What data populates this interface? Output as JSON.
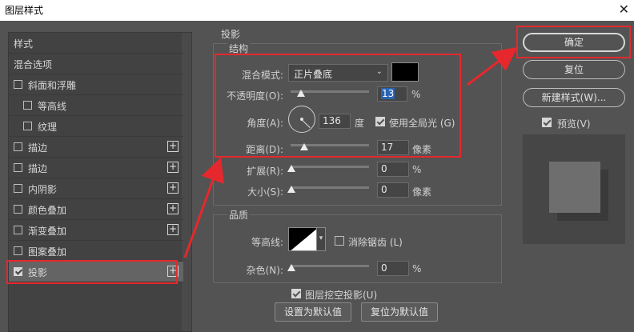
{
  "window": {
    "title": "图层样式",
    "close_glyph": "✕"
  },
  "sidebar": {
    "items": [
      {
        "label": "样式",
        "checkbox": false,
        "checked": false,
        "plus": false,
        "indent": 0
      },
      {
        "label": "混合选项",
        "checkbox": false,
        "checked": false,
        "plus": false,
        "indent": 0
      },
      {
        "label": "斜面和浮雕",
        "checkbox": true,
        "checked": false,
        "plus": false,
        "indent": 0
      },
      {
        "label": "等高线",
        "checkbox": true,
        "checked": false,
        "plus": false,
        "indent": 1
      },
      {
        "label": "纹理",
        "checkbox": true,
        "checked": false,
        "plus": false,
        "indent": 1
      },
      {
        "label": "描边",
        "checkbox": true,
        "checked": false,
        "plus": true,
        "indent": 0
      },
      {
        "label": "描边",
        "checkbox": true,
        "checked": false,
        "plus": true,
        "indent": 0
      },
      {
        "label": "内阴影",
        "checkbox": true,
        "checked": false,
        "plus": true,
        "indent": 0
      },
      {
        "label": "颜色叠加",
        "checkbox": true,
        "checked": false,
        "plus": true,
        "indent": 0
      },
      {
        "label": "渐变叠加",
        "checkbox": true,
        "checked": false,
        "plus": true,
        "indent": 0
      },
      {
        "label": "图案叠加",
        "checkbox": true,
        "checked": false,
        "plus": false,
        "indent": 0
      },
      {
        "label": "投影",
        "checkbox": true,
        "checked": true,
        "plus": true,
        "indent": 0,
        "active": true
      }
    ],
    "plus_glyph": "+"
  },
  "drop_shadow": {
    "section_title": "投影",
    "structure": {
      "title": "结构",
      "blend_mode_label": "混合模式:",
      "blend_mode_value": "正片叠底",
      "shadow_color": "#000000",
      "opacity_label": "不透明度(O):",
      "opacity_value": "13",
      "opacity_unit": "%",
      "angle_label": "角度(A):",
      "angle_value": "136",
      "angle_unit": "度",
      "global_light_label": "使用全局光 (G)",
      "global_light_checked": true,
      "distance_label": "距离(D):",
      "distance_value": "17",
      "distance_unit": "像素",
      "spread_label": "扩展(R):",
      "spread_value": "0",
      "spread_unit": "%",
      "size_label": "大小(S):",
      "size_value": "0",
      "size_unit": "像素"
    },
    "quality": {
      "title": "品质",
      "contour_label": "等高线:",
      "anti_alias_label": "消除锯齿 (L)",
      "anti_alias_checked": false,
      "noise_label": "杂色(N):",
      "noise_value": "0",
      "noise_unit": "%"
    },
    "knockout_label": "图层挖空投影(U)",
    "knockout_checked": true,
    "set_default_label": "设置为默认值",
    "reset_default_label": "复位为默认值"
  },
  "buttons": {
    "ok": "确定",
    "reset": "复位",
    "new_style": "新建样式(W)...",
    "preview_label": "预览(V)",
    "preview_checked": true
  },
  "colors": {
    "highlight": "#e5282d",
    "selection": "#2a63b4"
  },
  "icons": {
    "chevron": "⌄",
    "small_chevron": "▾"
  }
}
